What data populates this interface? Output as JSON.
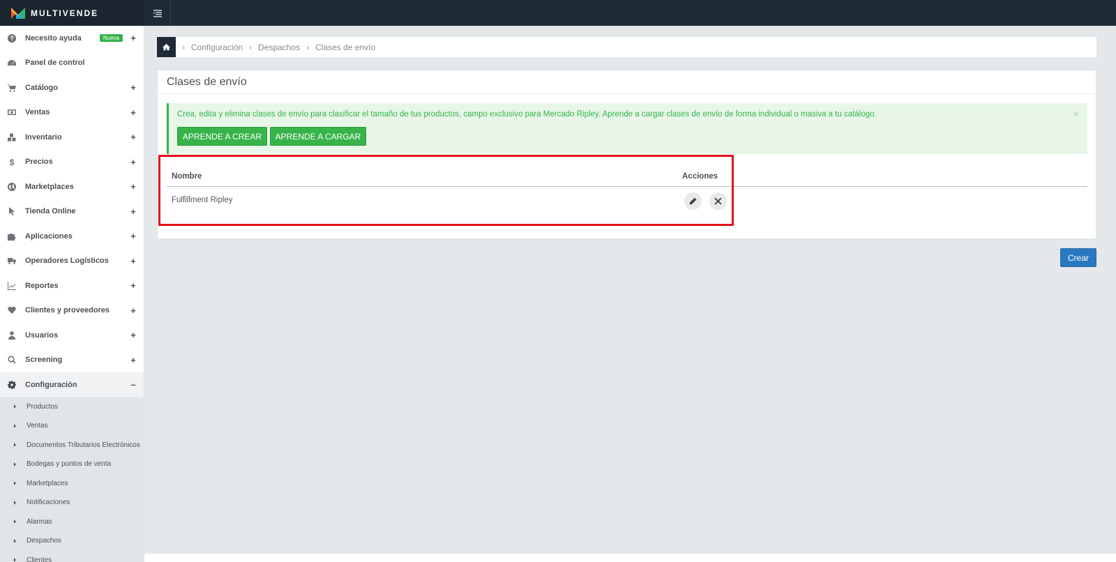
{
  "brand": {
    "name": "MULTIVENDE"
  },
  "sidebar": {
    "items": [
      {
        "label": "Necesito ayuda",
        "icon": "question-circle-icon",
        "badge": "Nueva",
        "toggle": "+"
      },
      {
        "label": "Panel de control",
        "icon": "dashboard-icon",
        "toggle": ""
      },
      {
        "label": "Catálogo",
        "icon": "cart-icon",
        "toggle": "+"
      },
      {
        "label": "Ventas",
        "icon": "money-icon",
        "toggle": "+"
      },
      {
        "label": "Inventario",
        "icon": "cubes-icon",
        "toggle": "+"
      },
      {
        "label": "Precios",
        "icon": "dollar-icon",
        "toggle": "+"
      },
      {
        "label": "Marketplaces",
        "icon": "globe-icon",
        "toggle": "+"
      },
      {
        "label": "Tienda Online",
        "icon": "pointer-icon",
        "toggle": "+"
      },
      {
        "label": "Aplicaciones",
        "icon": "puzzle-icon",
        "toggle": "+"
      },
      {
        "label": "Operadores Logísticos",
        "icon": "truck-icon",
        "toggle": "+"
      },
      {
        "label": "Reportes",
        "icon": "line-chart-icon",
        "toggle": "+"
      },
      {
        "label": "Clientes y proveedores",
        "icon": "heart-icon",
        "toggle": "+"
      },
      {
        "label": "Usuarios",
        "icon": "user-icon",
        "toggle": "+"
      },
      {
        "label": "Screening",
        "icon": "search-icon",
        "toggle": "+"
      },
      {
        "label": "Configuración",
        "icon": "gear-icon",
        "toggle": "–"
      }
    ],
    "subitems": [
      "Productos",
      "Ventas",
      "Documentos Tributarios Electrónicos",
      "Bodegas y puntos de venta",
      "Marketplaces",
      "Notificaciones",
      "Alarmas",
      "Despachos",
      "Clientes"
    ]
  },
  "breadcrumb": {
    "home_icon": "home-icon",
    "items": [
      "Configuración",
      "Despachos",
      "Clases de envío"
    ]
  },
  "panel": {
    "title": "Clases de envío",
    "alert": {
      "text": "Crea, edita y elimina clases de envío para clasificar el tamaño de tus productos, campo exclusivo para Mercado Ripley. Aprende a cargar clases de envío de forma individual o masiva a tu catálogo.",
      "close": "×",
      "button_create": "APRENDE A CREAR",
      "button_load": "APRENDE A CARGAR"
    },
    "table": {
      "headers": {
        "name": "Nombre",
        "actions": "Acciones"
      },
      "rows": [
        {
          "name": "Fulfillment Ripley"
        }
      ]
    }
  },
  "actions": {
    "create": "Crear"
  },
  "colors": {
    "topbar": "#1e2a35",
    "accent_green": "#37b34a",
    "accent_blue": "#2a79c0",
    "highlight": "#e0131b"
  }
}
